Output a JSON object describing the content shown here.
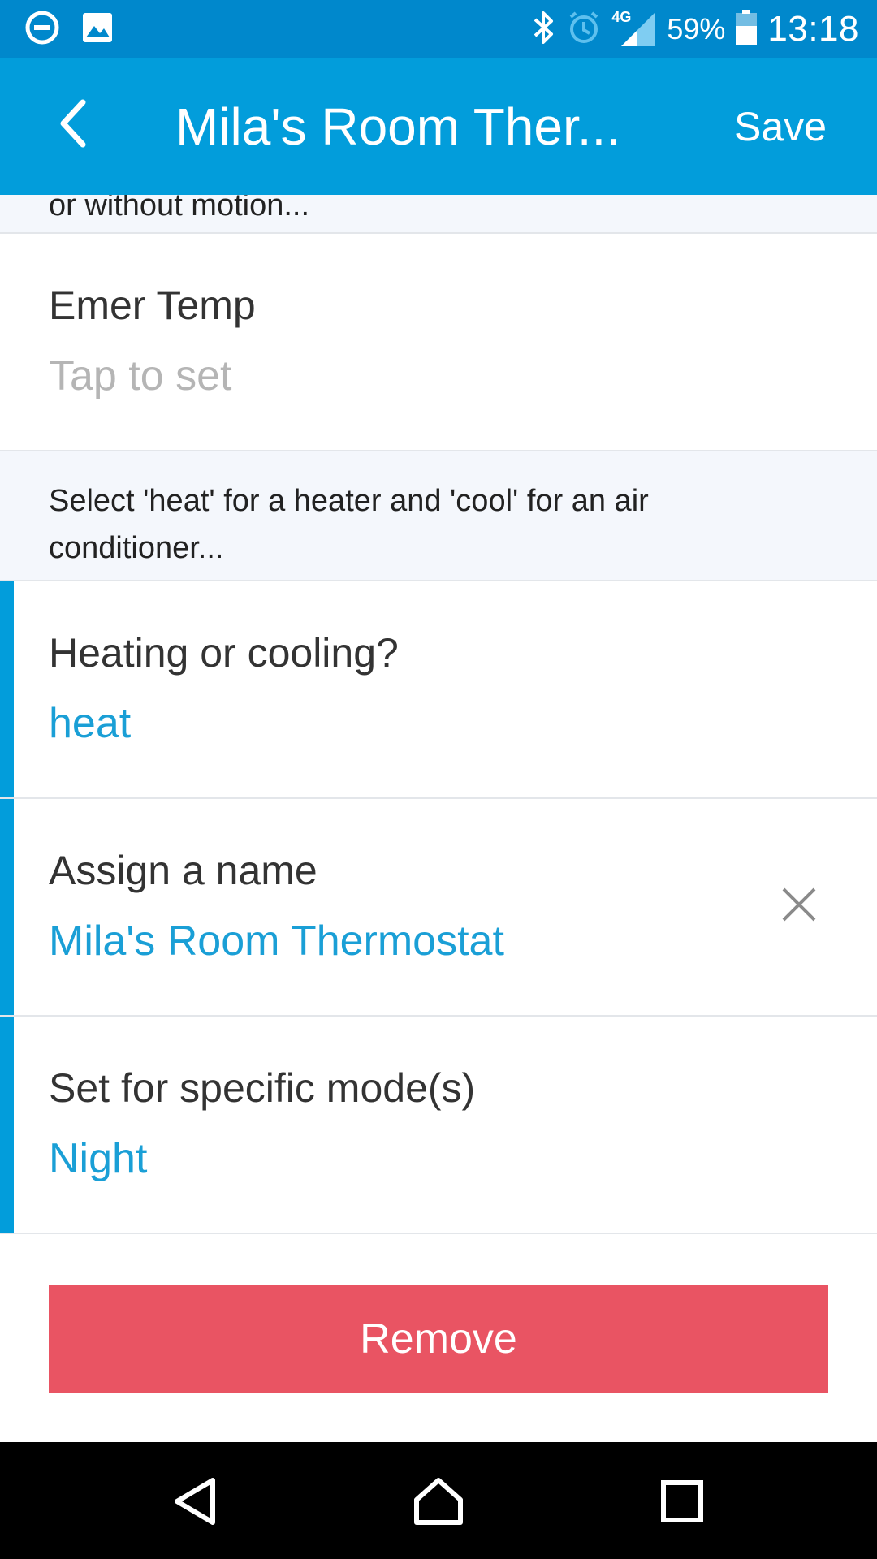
{
  "status_bar": {
    "left_icons": [
      "do-not-disturb-icon",
      "image-icon"
    ],
    "right_icons": [
      "bluetooth-icon",
      "alarm-icon",
      "signal-icon",
      "battery-icon"
    ],
    "network": "4G",
    "battery": "59%",
    "time": "13:18"
  },
  "app_bar": {
    "title": "Mila's Room Ther...",
    "save_label": "Save",
    "back_icon": "chevron-left-icon"
  },
  "sections": {
    "top_header": "or without motion...",
    "mid_header": "Select 'heat' for a heater and 'cool' for an air conditioner..."
  },
  "rows": {
    "emer_temp": {
      "label": "Emer Temp",
      "value": "Tap to set"
    },
    "heating_cooling": {
      "label": "Heating or cooling?",
      "value": "heat"
    },
    "assign_name": {
      "label": "Assign a name",
      "value": "Mila's Room Thermostat",
      "clear_icon": "close-icon"
    },
    "modes": {
      "label": "Set for specific mode(s)",
      "value": "Night"
    }
  },
  "remove_label": "Remove",
  "nav_bar": [
    "back-triangle-icon",
    "home-icon",
    "recents-icon"
  ],
  "colors": {
    "status_bar": "#0088cc",
    "app_bar": "#029ddb",
    "accent": "#029ddb",
    "value_text": "#1a9fd6",
    "placeholder": "#b5b5b5",
    "remove": "#e95463",
    "section_bg": "#f4f7fc"
  }
}
